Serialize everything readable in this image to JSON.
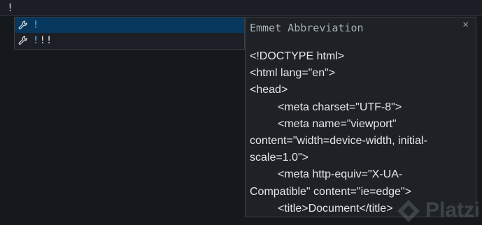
{
  "editor": {
    "typed_text": "!"
  },
  "suggestions": [
    {
      "prefix": "!",
      "rest": "",
      "selected": true,
      "icon": "wrench-icon"
    },
    {
      "prefix": "!",
      "rest": "!!",
      "selected": false,
      "icon": "wrench-icon"
    }
  ],
  "detail": {
    "title": "Emmet Abbreviation",
    "close": "×",
    "lines": [
      "<!DOCTYPE html>",
      "<html lang=\"en\">",
      "<head>",
      "<meta charset=\"UTF-8\">",
      "<meta name=\"viewport\"",
      "content=\"width=device-width, initial-scale=1.0\">",
      "<meta http-equiv=\"X-UA-",
      "Compatible\" content=\"ie=edge\">",
      "<title>Document</title>"
    ]
  },
  "watermark": {
    "text": "Platzi"
  },
  "colors": {
    "background": "#15181d",
    "selected_row": "#07375c",
    "highlight": "#2aa7ff"
  }
}
